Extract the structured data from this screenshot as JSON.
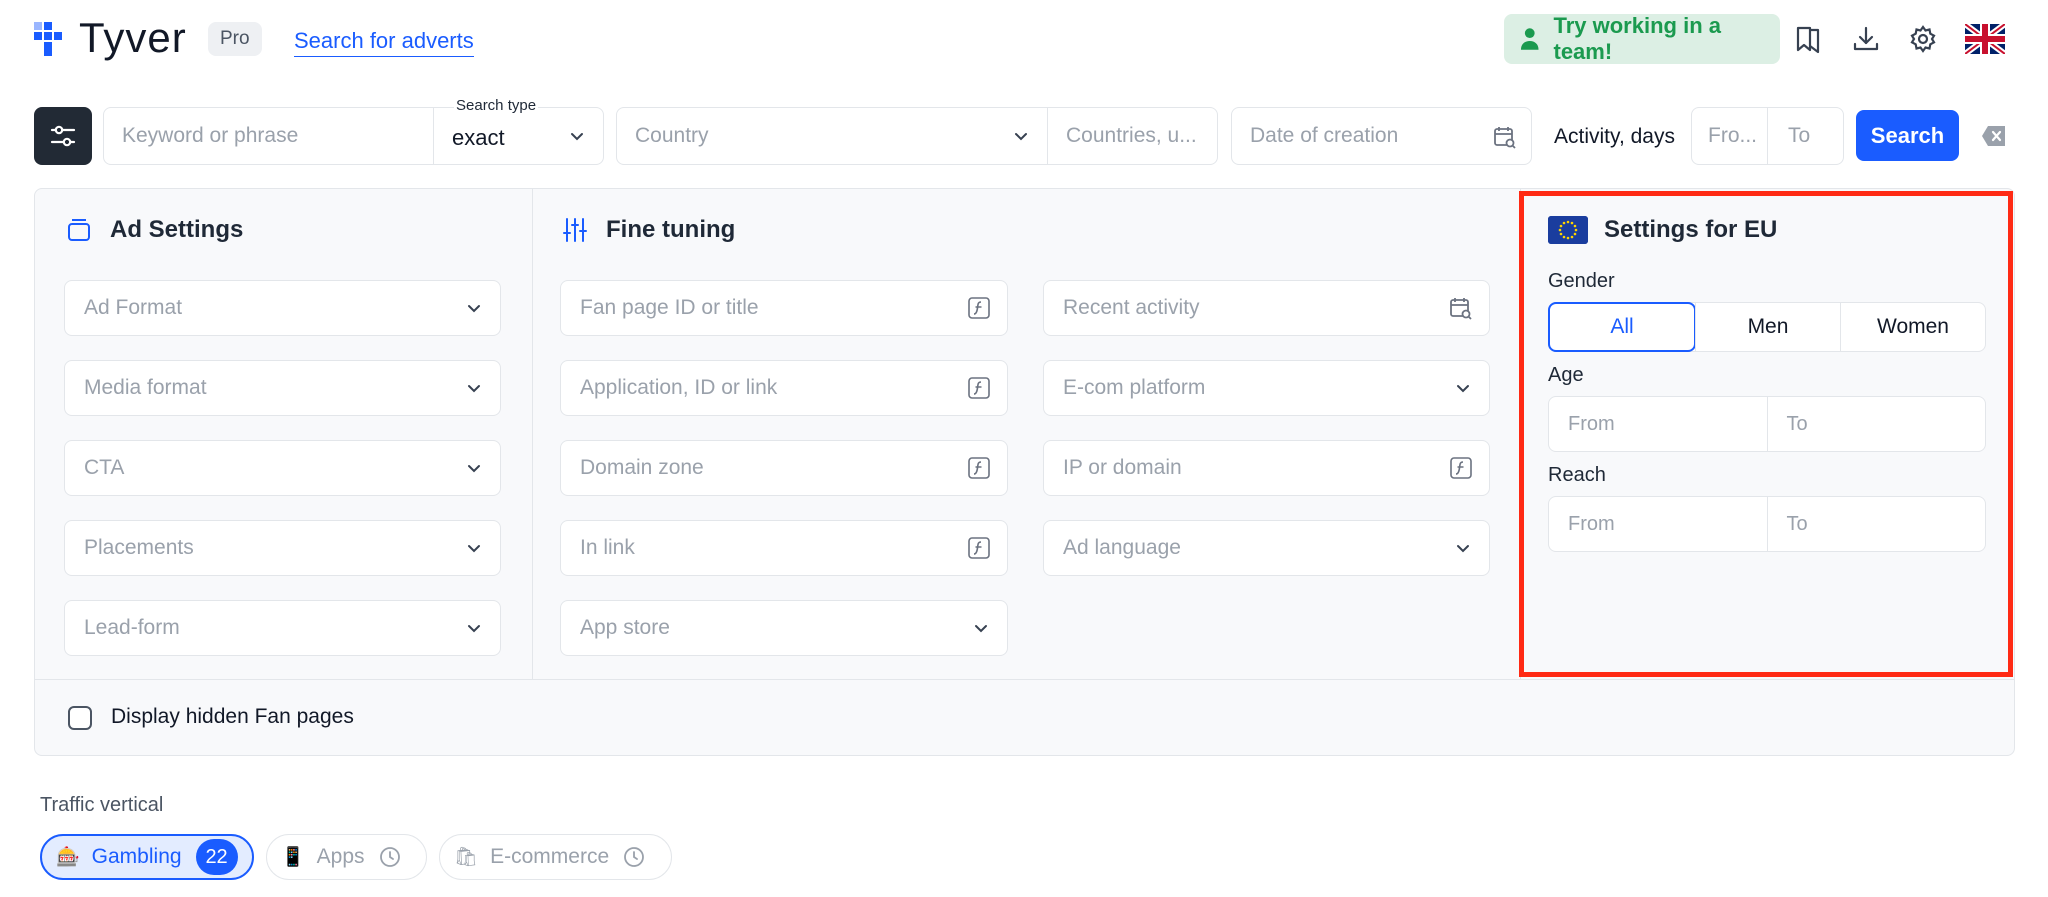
{
  "header": {
    "logo_text": "Tyver",
    "pro_label": "Pro",
    "search_adverts_link": "Search for adverts",
    "team_button": "Try working in a team!"
  },
  "search_bar": {
    "keyword_placeholder": "Keyword or phrase",
    "search_type_label": "Search type",
    "search_type_value": "exact",
    "country_placeholder": "Country",
    "countries_placeholder": "Countries, u...",
    "date_placeholder": "Date of creation",
    "activity_label": "Activity, days",
    "activity_from": "Fro...",
    "activity_to": "To",
    "search_button": "Search"
  },
  "ad_settings": {
    "title": "Ad Settings",
    "fields": [
      "Ad Format",
      "Media format",
      "CTA",
      "Placements",
      "Lead-form"
    ]
  },
  "fine_tuning": {
    "title": "Fine tuning",
    "left_fields": [
      "Fan page ID or title",
      "Application, ID or link",
      "Domain zone",
      "In link",
      "App store"
    ],
    "right_fields": [
      "Recent activity",
      "E-com platform",
      "IP or domain",
      "Ad language"
    ]
  },
  "eu_settings": {
    "title": "Settings for EU",
    "gender_label": "Gender",
    "gender_options": [
      "All",
      "Men",
      "Women"
    ],
    "gender_selected": "All",
    "age_label": "Age",
    "age_from": "From",
    "age_to": "To",
    "reach_label": "Reach",
    "reach_from": "From",
    "reach_to": "To"
  },
  "display_hidden_label": "Display hidden Fan pages",
  "traffic_vertical": {
    "label": "Traffic vertical",
    "chips": [
      {
        "label": "Gambling",
        "emoji": "🎰",
        "count": "22"
      },
      {
        "label": "Apps",
        "emoji": "📱"
      },
      {
        "label": "E-commerce",
        "emoji": "🛍"
      }
    ]
  },
  "colors": {
    "accent": "#1a5cff",
    "team_green": "#1b9a4f",
    "highlight_red": "#ff2a14",
    "dark_button": "#222a35"
  }
}
